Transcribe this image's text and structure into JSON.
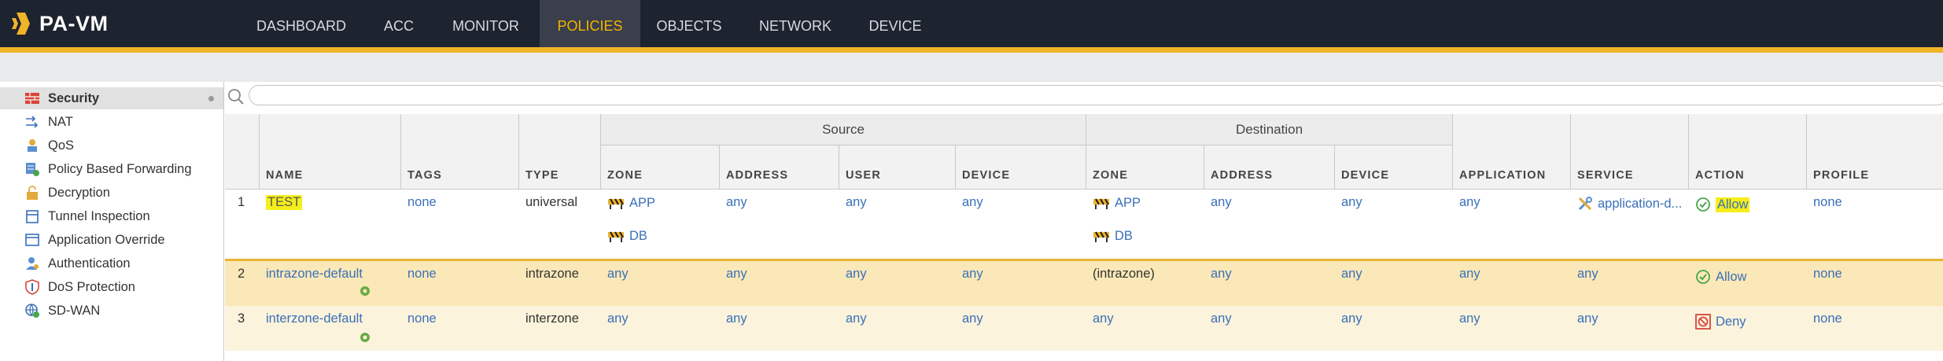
{
  "app": {
    "title": "PA-VM"
  },
  "nav": {
    "tabs": [
      "DASHBOARD",
      "ACC",
      "MONITOR",
      "POLICIES",
      "OBJECTS",
      "NETWORK",
      "DEVICE"
    ],
    "active": "POLICIES"
  },
  "sidebar": {
    "items": [
      {
        "label": "Security",
        "icon": "security-rules-icon"
      },
      {
        "label": "NAT",
        "icon": "nat-icon"
      },
      {
        "label": "QoS",
        "icon": "qos-icon"
      },
      {
        "label": "Policy Based Forwarding",
        "icon": "pbf-icon"
      },
      {
        "label": "Decryption",
        "icon": "decryption-lock-icon"
      },
      {
        "label": "Tunnel Inspection",
        "icon": "tunnel-inspection-icon"
      },
      {
        "label": "Application Override",
        "icon": "app-override-icon"
      },
      {
        "label": "Authentication",
        "icon": "authentication-icon"
      },
      {
        "label": "DoS Protection",
        "icon": "dos-shield-icon"
      },
      {
        "label": "SD-WAN",
        "icon": "sdwan-globe-icon"
      }
    ]
  },
  "search": {
    "placeholder": ""
  },
  "table": {
    "groups": {
      "source": "Source",
      "destination": "Destination"
    },
    "headers": {
      "name": "NAME",
      "tags": "TAGS",
      "type": "TYPE",
      "src_zone": "ZONE",
      "src_address": "ADDRESS",
      "src_user": "USER",
      "src_device": "DEVICE",
      "dst_zone": "ZONE",
      "dst_address": "ADDRESS",
      "dst_device": "DEVICE",
      "application": "APPLICATION",
      "service": "SERVICE",
      "action": "ACTION",
      "profile": "PROFILE"
    },
    "rows": [
      {
        "num": "1",
        "name": "TEST",
        "tags": "none",
        "type": "universal",
        "src_zone": [
          "APP",
          "DB"
        ],
        "src_address": "any",
        "src_user": "any",
        "src_device": "any",
        "dst_zone": [
          "APP",
          "DB"
        ],
        "dst_address": "any",
        "dst_device": "any",
        "application": "any",
        "service": "application-d...",
        "action": "Allow",
        "profile": "none"
      },
      {
        "num": "2",
        "name": "intrazone-default",
        "tags": "none",
        "type": "intrazone",
        "src_zone": "any",
        "src_address": "any",
        "src_user": "any",
        "src_device": "any",
        "dst_zone": "(intrazone)",
        "dst_address": "any",
        "dst_device": "any",
        "application": "any",
        "service": "any",
        "action": "Allow",
        "profile": "none"
      },
      {
        "num": "3",
        "name": "interzone-default",
        "tags": "none",
        "type": "interzone",
        "src_zone": "any",
        "src_address": "any",
        "src_user": "any",
        "src_device": "any",
        "dst_zone": "any",
        "dst_address": "any",
        "dst_device": "any",
        "application": "any",
        "service": "any",
        "action": "Deny",
        "profile": "none"
      }
    ]
  },
  "colors": {
    "topbar": "#1e2330",
    "accent": "#f0b429",
    "active_tab_text": "#f5b400",
    "link": "#3a70b8",
    "highlight": "#f5ee1a",
    "row_selected": "#fbe8b8",
    "row_default": "#fcf3dc",
    "allow": "#4aa54a",
    "deny": "#d9453a"
  }
}
